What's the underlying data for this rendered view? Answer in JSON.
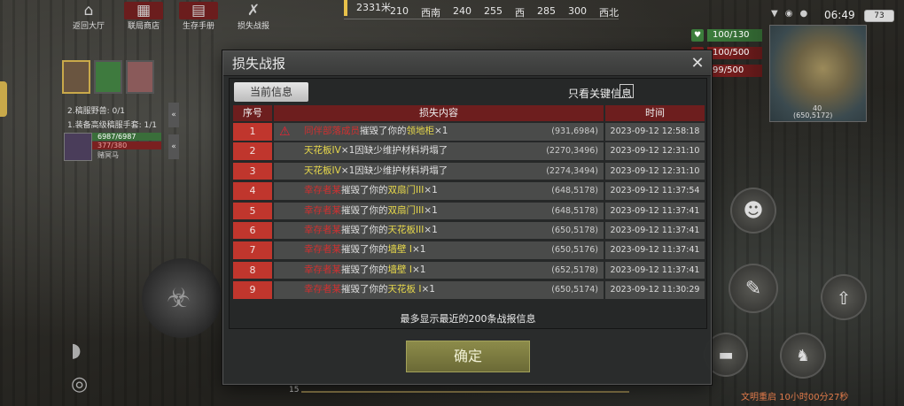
{
  "topnav": [
    {
      "label": "返回大厅",
      "icon": "home-icon"
    },
    {
      "label": "联局商店",
      "icon": "shop-icon"
    },
    {
      "label": "生存手册",
      "icon": "book-icon"
    },
    {
      "label": "损失战报",
      "icon": "weapon-icon"
    }
  ],
  "compass": {
    "distance": "2331米",
    "ticks": [
      "210",
      "西南",
      "240",
      "255",
      "西",
      "285",
      "300",
      "西北"
    ]
  },
  "status": {
    "time": "06:49",
    "battery": "73"
  },
  "bars": {
    "hp": "100/130",
    "food": "100/500",
    "water": "99/500"
  },
  "minimap": {
    "label": "40",
    "coords": "(650,5172)"
  },
  "quests": [
    "2.稿服野兽: 0/1",
    "1.装备高级稿服手套: 1/1"
  ],
  "player": {
    "hp": "6987/6987",
    "mana": "377/380",
    "name": "赌冥马"
  },
  "dialog": {
    "title": "损失战报",
    "tab_current": "当前信息",
    "key_only_label": "只看关键信息",
    "headers": {
      "no": "序号",
      "content": "损失内容",
      "time": "时间"
    },
    "rows": [
      {
        "no": "1",
        "actor": "同伴部落成员",
        "action": "摧毁了你的",
        "item": "领地柜",
        "suffix": "×1",
        "coord": "(931,6984)",
        "time": "2023-09-12 12:58:18",
        "warn": true
      },
      {
        "no": "2",
        "actor": "",
        "action": "",
        "item": "天花板IV",
        "suffix": "×1因缺少维护材料坍塌了",
        "coord": "(2270,3496)",
        "time": "2023-09-12 12:31:10",
        "warn": false
      },
      {
        "no": "3",
        "actor": "",
        "action": "",
        "item": "天花板IV",
        "suffix": "×1因缺少维护材料坍塌了",
        "coord": "(2274,3494)",
        "time": "2023-09-12 12:31:10",
        "warn": false
      },
      {
        "no": "4",
        "actor": "幸存者某",
        "action": "摧毁了你的",
        "item": "双扇门III",
        "suffix": "×1",
        "coord": "(648,5178)",
        "time": "2023-09-12 11:37:54",
        "warn": false
      },
      {
        "no": "5",
        "actor": "幸存者某",
        "action": "摧毁了你的",
        "item": "双扇门III",
        "suffix": "×1",
        "coord": "(648,5178)",
        "time": "2023-09-12 11:37:41",
        "warn": false
      },
      {
        "no": "6",
        "actor": "幸存者某",
        "action": "摧毁了你的",
        "item": "天花板III",
        "suffix": "×1",
        "coord": "(650,5178)",
        "time": "2023-09-12 11:37:41",
        "warn": false
      },
      {
        "no": "7",
        "actor": "幸存者某",
        "action": "摧毁了你的",
        "item": "墙壁 I",
        "suffix": "×1",
        "coord": "(650,5176)",
        "time": "2023-09-12 11:37:41",
        "warn": false
      },
      {
        "no": "8",
        "actor": "幸存者某",
        "action": "摧毁了你的",
        "item": "墙壁 I",
        "suffix": "×1",
        "coord": "(652,5178)",
        "time": "2023-09-12 11:37:41",
        "warn": false
      },
      {
        "no": "9",
        "actor": "幸存者某",
        "action": "摧毁了你的",
        "item": "天花板 I",
        "suffix": "×1",
        "coord": "(650,5174)",
        "time": "2023-09-12 11:30:29",
        "warn": false
      }
    ],
    "footnote": "最多显示最近的200条战报信息",
    "confirm_label": "确定"
  },
  "bottom": {
    "level": "15",
    "right_text": "文明重启 10小时00分27秒"
  }
}
